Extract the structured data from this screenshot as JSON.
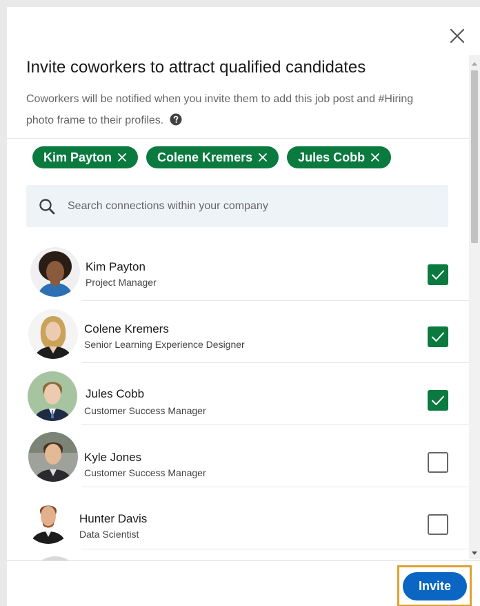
{
  "dialog": {
    "title": "Invite coworkers to attract qualified candidates",
    "subtitle": "Coworkers will be notified when you invite them to add this job post and #Hiring photo frame to their profiles."
  },
  "selected": [
    {
      "label": "Kim Payton"
    },
    {
      "label": "Colene Kremers"
    },
    {
      "label": "Jules Cobb"
    }
  ],
  "search": {
    "placeholder": "Search connections within your company",
    "value": ""
  },
  "people": [
    {
      "name": "Kim Payton",
      "role": "Project Manager",
      "checked": true
    },
    {
      "name": "Colene Kremers",
      "role": "Senior Learning Experience Designer",
      "checked": true
    },
    {
      "name": "Jules Cobb",
      "role": "Customer Success Manager",
      "checked": true
    },
    {
      "name": "Kyle Jones",
      "role": "Customer Success Manager",
      "checked": false
    },
    {
      "name": "Hunter Davis",
      "role": "Data Scientist",
      "checked": false
    }
  ],
  "footer": {
    "invite_label": "Invite"
  },
  "colors": {
    "accent_green": "#0a7a3f",
    "primary_blue": "#0a66c2",
    "highlight_orange": "#e0a030"
  },
  "icons": {
    "close": "close-icon",
    "help": "help-icon",
    "search": "search-icon",
    "pill_remove": "x-icon",
    "checkmark": "check-icon"
  }
}
